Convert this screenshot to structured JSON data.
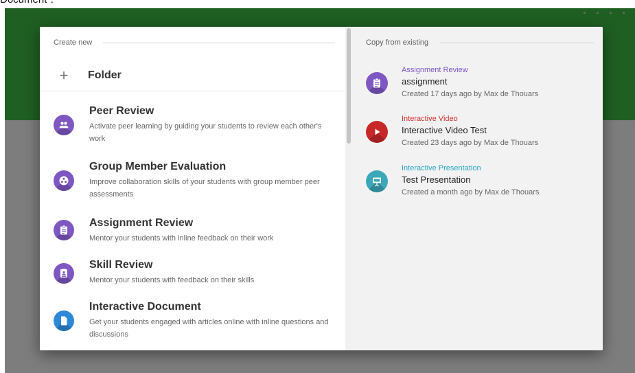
{
  "caption": "Document\".",
  "colors": {
    "purple": "#7e57c2",
    "red": "#c62828",
    "teal": "#3aa8b8",
    "blue": "#2e88d8",
    "green_header": "#1f5f22"
  },
  "create_new": {
    "header": "Create new",
    "folder": {
      "label": "Folder",
      "icon": "plus-icon"
    },
    "tools": [
      {
        "title": "Peer Review",
        "description": "Activate peer learning by guiding your students to review each other's work",
        "icon": "people-icon",
        "color": "#7e57c2"
      },
      {
        "title": "Group Member Evaluation",
        "description": "Improve collaboration skills of your students with group member peer assessments",
        "icon": "group-icon",
        "color": "#7e57c2"
      },
      {
        "title": "Assignment Review",
        "description": "Mentor your students with inline feedback on their work",
        "icon": "clipboard-icon",
        "color": "#7e57c2"
      },
      {
        "title": "Skill Review",
        "description": "Mentor your students with feedback on their skills",
        "icon": "badge-icon",
        "color": "#7e57c2"
      },
      {
        "title": "Interactive Document",
        "description": "Get your students engaged with articles online with inline questions and discussions",
        "icon": "document-icon",
        "color": "#2e88d8"
      }
    ]
  },
  "copy_existing": {
    "header": "Copy from existing",
    "items": [
      {
        "type": "Assignment Review",
        "type_color": "#7e57c2",
        "title": "assignment",
        "meta": "Created 17 days ago by Max de Thouars",
        "icon": "clipboard-icon",
        "color": "#7e57c2"
      },
      {
        "type": "Interactive Video",
        "type_color": "#d32f2f",
        "title": "Interactive Video Test",
        "meta": "Created 23 days ago by Max de Thouars",
        "icon": "play-icon",
        "color": "#c62828"
      },
      {
        "type": "Interactive Presentation",
        "type_color": "#26a6c4",
        "title": "Test Presentation",
        "meta": "Created a month ago by Max de Thouars",
        "icon": "presentation-icon",
        "color": "#3aa8b8"
      }
    ]
  }
}
